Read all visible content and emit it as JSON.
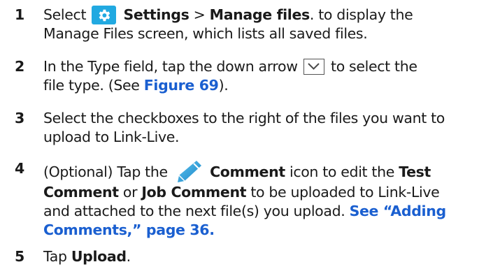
{
  "steps": [
    {
      "number": "1",
      "select": "Select",
      "settings": "Settings",
      "sep": ">",
      "manage_files": "Manage files",
      "rest1": ". to display the",
      "line2": "Manage Files screen, which lists all saved files."
    },
    {
      "number": "2",
      "pre": "In the Type field, tap the down arrow",
      "post": "to select the",
      "line2_pre": "file type. (See",
      "figure_link": "Figure 69",
      "line2_post": ")."
    },
    {
      "number": "3",
      "line1": "Select the checkboxes to the right of the files you want to",
      "line2": "upload to Link-Live."
    },
    {
      "number": "4",
      "pre": "(Optional) Tap the",
      "comment": "Comment",
      "icon_text": "icon to edit the",
      "test": "Test",
      "comment2": "Comment",
      "or": "or",
      "job_comment": "Job Comment",
      "line2_rest": "to be uploaded to Link-Live",
      "line3_pre": "and attached to the next file(s) you upload.",
      "see_link": "See “Adding",
      "line4_link": "Comments,” page 36."
    },
    {
      "number": "5",
      "tap": "Tap",
      "upload": "Upload",
      "end": "."
    }
  ],
  "icons": {
    "settings": "gear-icon",
    "dropdown": "chevron-down-icon",
    "comment": "pencil-icon"
  },
  "colors": {
    "link": "#1a5fd0",
    "gear_bg": "#21a9e1",
    "pencil": "#2da3dc"
  }
}
